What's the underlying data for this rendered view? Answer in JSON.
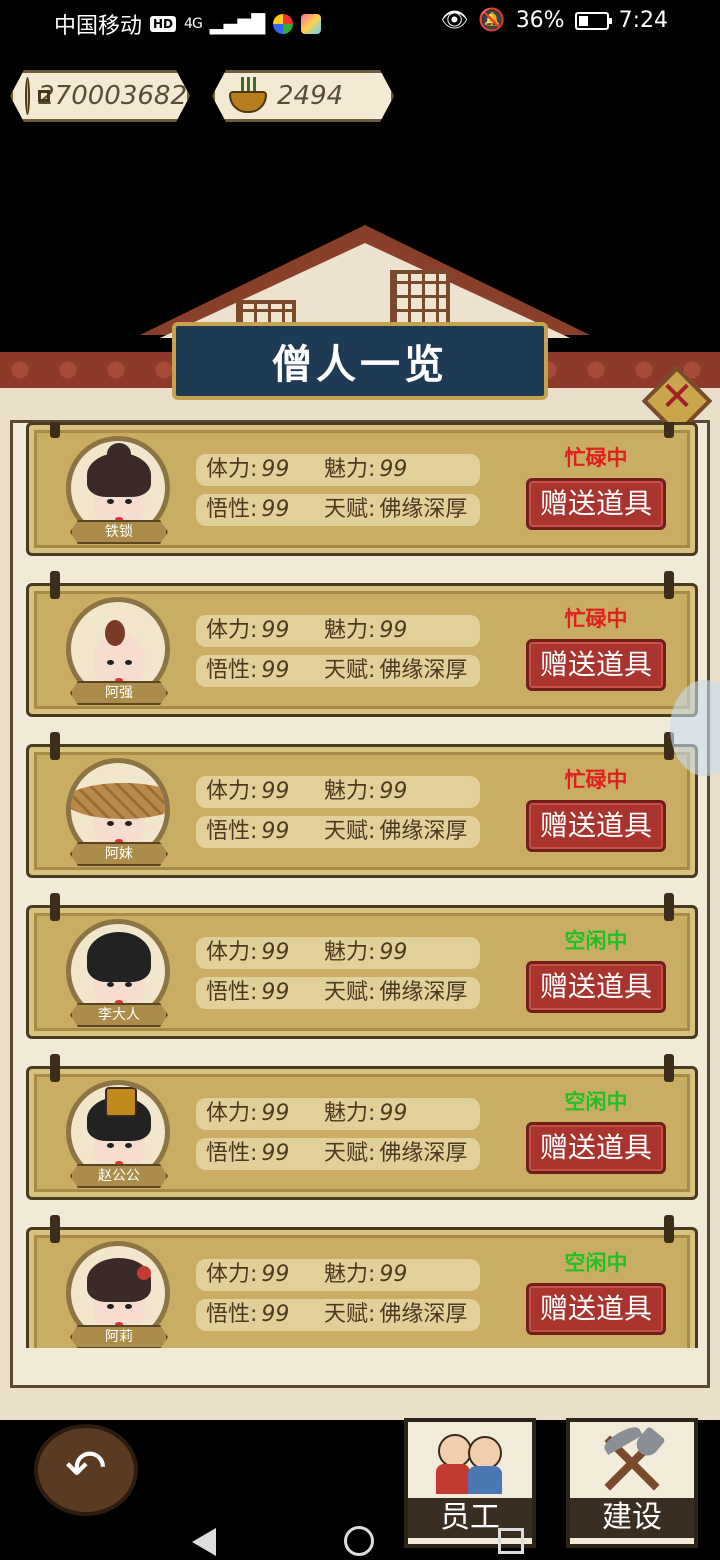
{
  "status_bar": {
    "carrier": "中国移动",
    "hd": "HD",
    "signal": "4G",
    "battery": "36%",
    "time": "7:24",
    "battery_level": 0.36
  },
  "currency": {
    "coins": "270003682",
    "incense": "2494"
  },
  "title": "僧人一览",
  "labels": {
    "stamina": "体力:",
    "charm": "魅力:",
    "insight": "悟性:",
    "talent": "天赋:",
    "gift_button": "赠送道具"
  },
  "monks": [
    {
      "name": "铁锁",
      "stamina": "99",
      "charm": "99",
      "insight": "99",
      "talent": "佛缘深厚",
      "status": "忙碌中",
      "status_color": "#e02020"
    },
    {
      "name": "阿强",
      "stamina": "99",
      "charm": "99",
      "insight": "99",
      "talent": "佛缘深厚",
      "status": "忙碌中",
      "status_color": "#e02020"
    },
    {
      "name": "阿妹",
      "stamina": "99",
      "charm": "99",
      "insight": "99",
      "talent": "佛缘深厚",
      "status": "忙碌中",
      "status_color": "#e02020"
    },
    {
      "name": "李大人",
      "stamina": "99",
      "charm": "99",
      "insight": "99",
      "talent": "佛缘深厚",
      "status": "空闲中",
      "status_color": "#22c022"
    },
    {
      "name": "赵公公",
      "stamina": "99",
      "charm": "99",
      "insight": "99",
      "talent": "佛缘深厚",
      "status": "空闲中",
      "status_color": "#22c022"
    },
    {
      "name": "阿莉",
      "stamina": "99",
      "charm": "99",
      "insight": "99",
      "talent": "佛缘深厚",
      "status": "空闲中",
      "status_color": "#22c022"
    }
  ],
  "bottom_tabs": {
    "staff": "员工",
    "build": "建设"
  }
}
